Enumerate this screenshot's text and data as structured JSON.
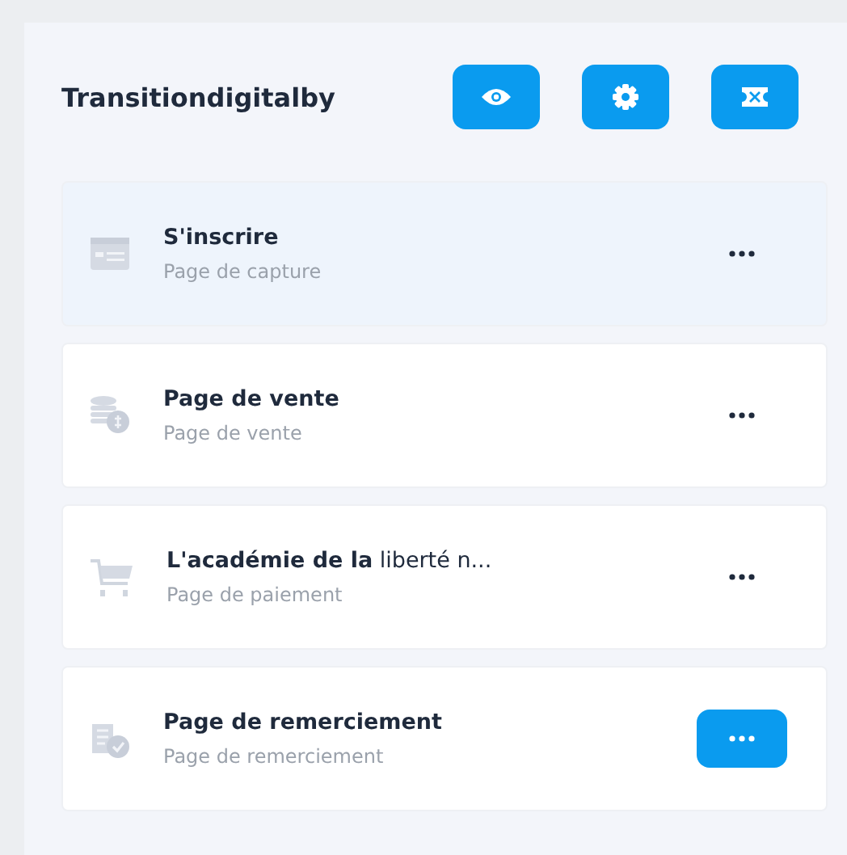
{
  "header": {
    "title": "Transitiondigitalby"
  },
  "toolbar": [
    {
      "kind": "preview"
    },
    {
      "kind": "settings"
    },
    {
      "kind": "swap"
    }
  ],
  "pages": [
    {
      "kind": "form",
      "title": "S'inscrire",
      "subtitle": "Page de capture",
      "selected": true,
      "menu_open": false
    },
    {
      "kind": "sales",
      "title": "Page de vente",
      "subtitle": "Page de vente",
      "selected": false,
      "menu_open": false
    },
    {
      "kind": "cart",
      "title": "**L'académie de la** liberté n...",
      "subtitle": "Page de paiement",
      "selected": false,
      "menu_open": false
    },
    {
      "kind": "thanks",
      "title": "Page de remerciement",
      "subtitle": "Page de remerciement",
      "selected": false,
      "menu_open": true
    }
  ]
}
